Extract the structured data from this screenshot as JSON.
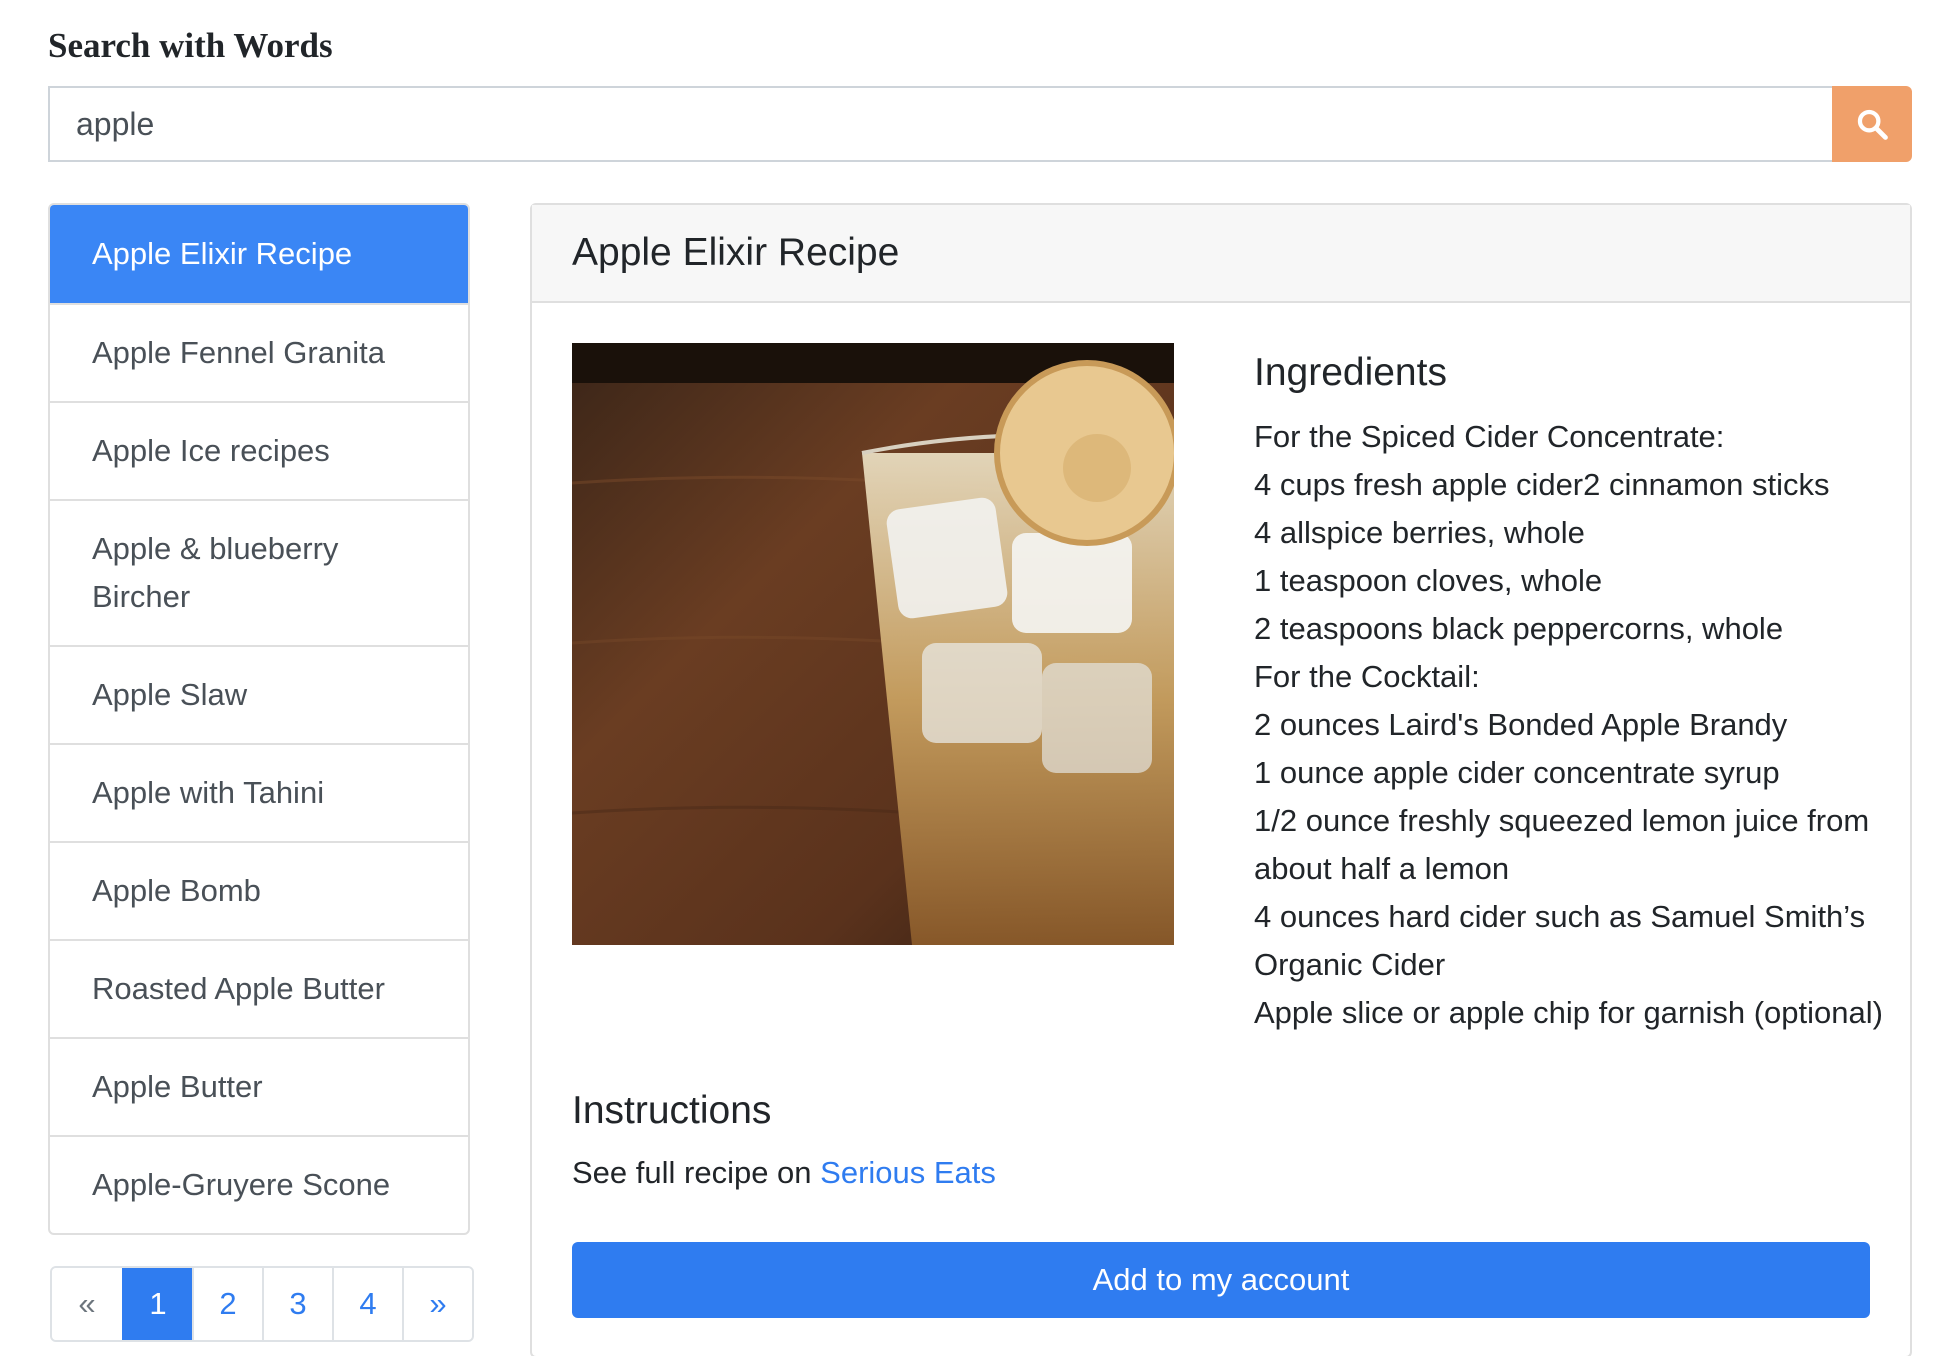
{
  "header": {
    "title": "Search with Words"
  },
  "search": {
    "value": "apple",
    "button_icon": "search-icon",
    "button_color": "#f0a06a"
  },
  "results": {
    "items": [
      {
        "label": "Apple Elixir Recipe",
        "active": true
      },
      {
        "label": "Apple Fennel Granita",
        "active": false
      },
      {
        "label": "Apple Ice recipes",
        "active": false
      },
      {
        "label": "Apple & blueberry Bircher",
        "active": false
      },
      {
        "label": "Apple Slaw",
        "active": false
      },
      {
        "label": "Apple with Tahini",
        "active": false
      },
      {
        "label": "Apple Bomb",
        "active": false
      },
      {
        "label": "Roasted Apple Butter",
        "active": false
      },
      {
        "label": "Apple Butter",
        "active": false
      },
      {
        "label": "Apple-Gruyere Scone",
        "active": false
      }
    ]
  },
  "pagination": {
    "prev": "«",
    "pages": [
      "1",
      "2",
      "3",
      "4"
    ],
    "current": "1",
    "next": "»"
  },
  "recipe": {
    "title": "Apple Elixir Recipe",
    "ingredients_heading": "Ingredients",
    "ingredients": [
      "For the Spiced Cider Concentrate:",
      "4 cups fresh apple cider2 cinnamon sticks",
      "4 allspice berries, whole",
      "1 teaspoon cloves, whole",
      "2 teaspoons black peppercorns, whole",
      "For the Cocktail:",
      "2 ounces Laird's Bonded Apple Brandy",
      "1 ounce apple cider concentrate syrup",
      "1/2 ounce freshly squeezed lemon juice from about half a lemon",
      "4 ounces hard cider such as Samuel Smith’s Organic Cider",
      "Apple slice or apple chip for garnish (optional)"
    ],
    "instructions_heading": "Instructions",
    "instructions_prefix": "See full recipe on ",
    "instructions_link": "Serious Eats",
    "add_button": "Add to my account"
  },
  "colors": {
    "accent": "#2f7cf0",
    "active_item": "#3a86f5",
    "search_button": "#f0a06a"
  }
}
